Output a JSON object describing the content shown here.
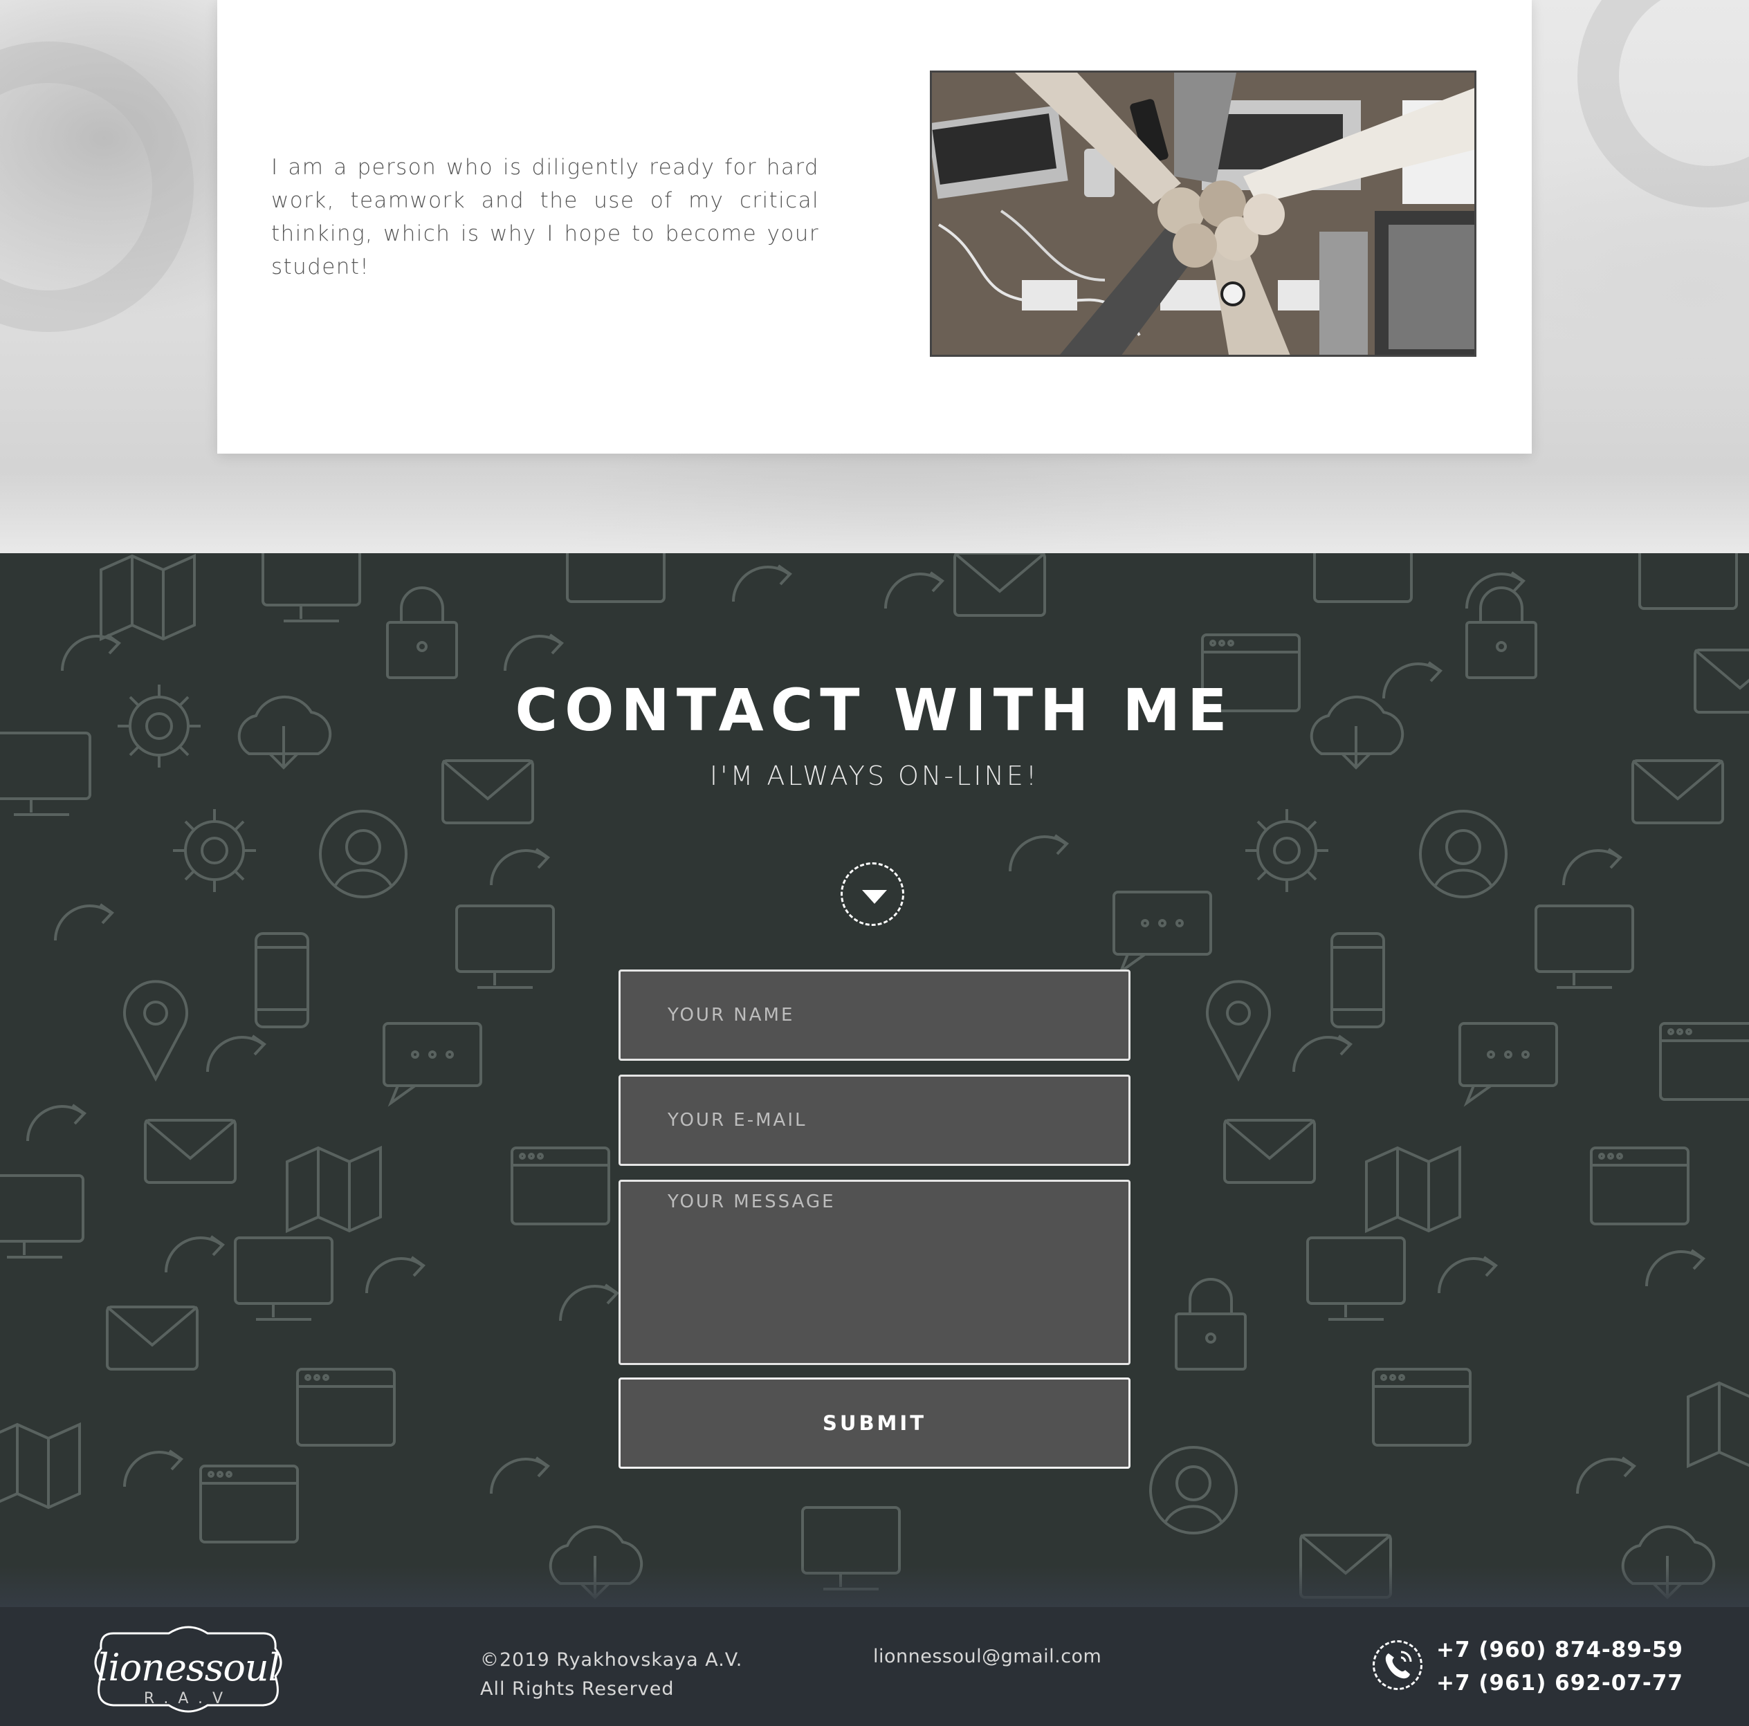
{
  "about": {
    "text": "I am a person who is diligently ready for hard work, teamwork and the use of my critical thinking, which is why I hope to become your student!",
    "photo_icon": "teamwork-photo"
  },
  "contact": {
    "title": "CONTACT WITH ME",
    "subtitle": "I'M ALWAYS ON-LINE!",
    "scroll_icon": "chevron-down-icon",
    "form": {
      "name_placeholder": "YOUR NAME",
      "email_placeholder": "YOUR E-MAIL",
      "message_placeholder": "YOUR MESSAGE",
      "submit_label": "SUBMIT"
    }
  },
  "footer": {
    "logo_text": "lionessoul",
    "logo_sub": "R.A.V",
    "copyright_line1": "©2019 Ryakhovskaya A.V.",
    "copyright_line2": "All Rights Reserved",
    "email": "lionnessoul@gmail.com",
    "phone_icon": "phone-icon",
    "phone1": "+7 (960) 874-89-59",
    "phone2": "+7 (961) 692-07-77"
  },
  "colors": {
    "contact_bg": "#2f3634",
    "footer_bg": "#2b3036",
    "field_bg": "#525252"
  }
}
